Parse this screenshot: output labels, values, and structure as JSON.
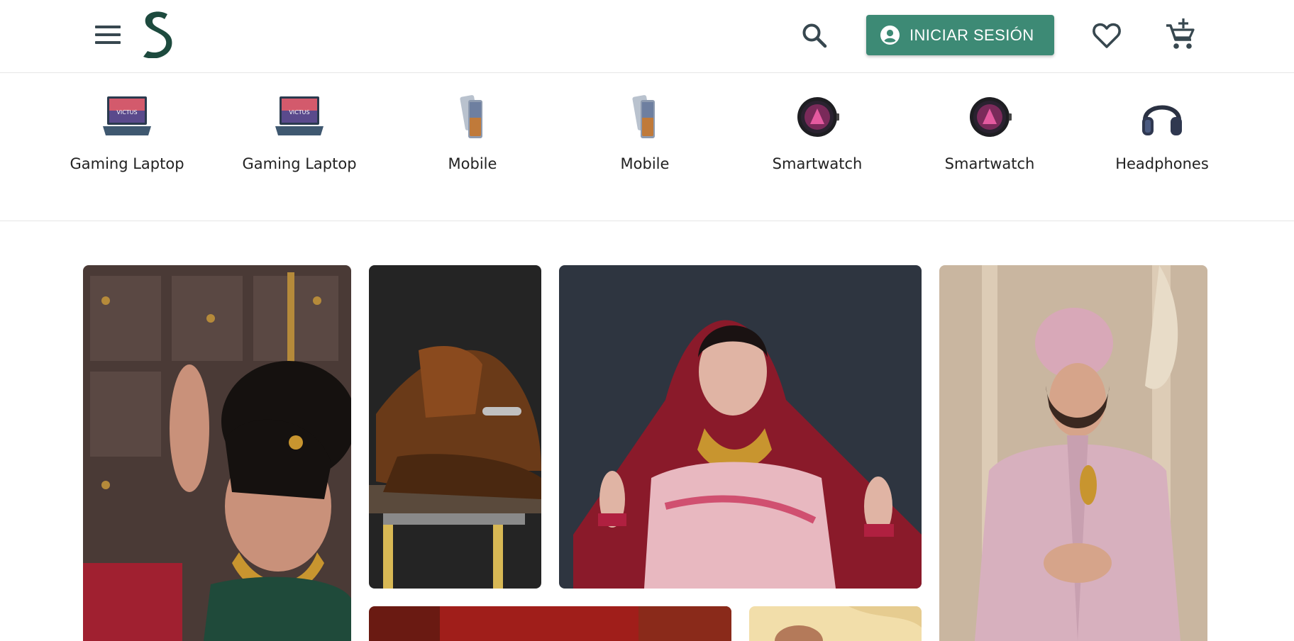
{
  "header": {
    "menu_icon": "hamburger-menu-icon",
    "logo_icon": "s-logo-icon",
    "search_icon": "search-icon",
    "login_label": "INICIAR SESIÓN",
    "login_icon": "account-circle-icon",
    "wishlist_icon": "heart-outline-icon",
    "cart_icon": "add-shopping-cart-icon",
    "colors": {
      "brand": "#1d4a3e",
      "button": "#3d8a75",
      "icon": "#37474f"
    }
  },
  "categories": [
    {
      "label": "Gaming Laptop",
      "icon": "laptop-icon"
    },
    {
      "label": "Gaming Laptop",
      "icon": "laptop-icon"
    },
    {
      "label": "Mobile",
      "icon": "smartphone-icon"
    },
    {
      "label": "Mobile",
      "icon": "smartphone-icon"
    },
    {
      "label": "Smartwatch",
      "icon": "smartwatch-icon"
    },
    {
      "label": "Smartwatch",
      "icon": "smartwatch-icon"
    },
    {
      "label": "Headphones",
      "icon": "headphones-icon"
    }
  ],
  "gallery": [
    {
      "subject": "woman-gold-jewelry-photo"
    },
    {
      "subject": "brown-loafer-shoes-photo"
    },
    {
      "subject": "bride-red-veil-photo"
    },
    {
      "subject": "groom-pink-sherwani-photo"
    },
    {
      "subject": "red-fabric-photo"
    },
    {
      "subject": "cream-fabric-photo"
    }
  ]
}
